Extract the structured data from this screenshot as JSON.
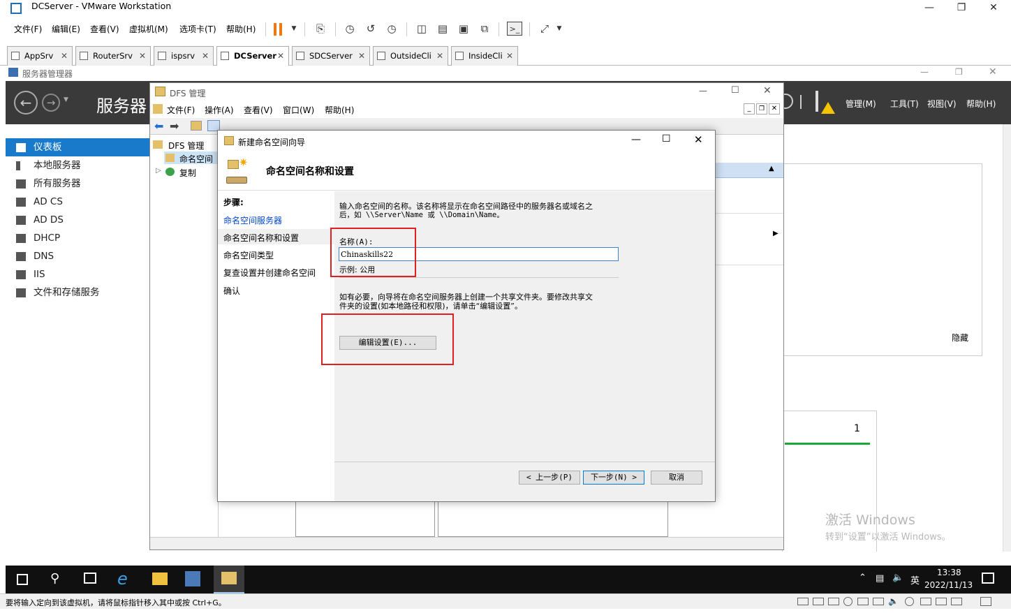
{
  "vmware": {
    "title": "DCServer - VMware Workstation",
    "menu": [
      "文件(F)",
      "编辑(E)",
      "查看(V)",
      "虚拟机(M)",
      "选项卡(T)",
      "帮助(H)"
    ],
    "tabs": [
      {
        "label": "AppSrv",
        "active": false
      },
      {
        "label": "RouterSrv",
        "active": false
      },
      {
        "label": "ispsrv",
        "active": false
      },
      {
        "label": "DCServer",
        "active": true
      },
      {
        "label": "SDCServer",
        "active": false
      },
      {
        "label": "OutsideCli",
        "active": false
      },
      {
        "label": "InsideCli",
        "active": false
      }
    ],
    "status_hint": "要将输入定向到该虚拟机，请将鼠标指针移入其中或按 Ctrl+G。"
  },
  "server_manager": {
    "title": "服务器管理器",
    "header_title": "服务器",
    "header_menu": [
      "管理(M)",
      "工具(T)",
      "视图(V)",
      "帮助(H)"
    ],
    "nav": [
      {
        "label": "仪表板",
        "selected": true
      },
      {
        "label": "本地服务器",
        "selected": false
      },
      {
        "label": "所有服务器",
        "selected": false
      },
      {
        "label": "AD CS",
        "selected": false
      },
      {
        "label": "AD DS",
        "selected": false
      },
      {
        "label": "DHCP",
        "selected": false
      },
      {
        "label": "DNS",
        "selected": false
      },
      {
        "label": "IIS",
        "selected": false
      },
      {
        "label": "文件和存储服务",
        "selected": false
      }
    ],
    "hide_label": "隐藏",
    "tile_count": "1"
  },
  "dfs": {
    "title": "DFS 管理",
    "menu": [
      "文件(F)",
      "操作(A)",
      "查看(V)",
      "窗口(W)",
      "帮助(H)"
    ],
    "tree": {
      "root": "DFS 管理",
      "namespaces": "命名空间",
      "replication": "复制"
    }
  },
  "wizard": {
    "title": "新建命名空间向导",
    "heading": "命名空间名称和设置",
    "steps_header": "步骤:",
    "steps": [
      {
        "label": "命名空间服务器",
        "state": "link"
      },
      {
        "label": "命名空间名称和设置",
        "state": "current"
      },
      {
        "label": "命名空间类型",
        "state": "normal"
      },
      {
        "label": "复查设置并创建命名空间",
        "state": "normal"
      },
      {
        "label": "确认",
        "state": "normal"
      }
    ],
    "intro_line1": "输入命名空间的名称。该名称将显示在命名空间路径中的服务器名或域名之",
    "intro_line2": "后，如 \\\\Server\\Name 或 \\\\Domain\\Name。",
    "name_label": "名称(A):",
    "name_value": "Chinaskills22",
    "example": "示例: 公用",
    "share_note_line1": "如有必要，向导将在命名空间服务器上创建一个共享文件夹。要修改共享文",
    "share_note_line2": "件夹的设置(如本地路径和权限)，请单击“编辑设置”。",
    "edit_button": "编辑设置(E)...",
    "back_button": "< 上一步(P)",
    "next_button": "下一步(N) >",
    "cancel_button": "取消"
  },
  "watermark": {
    "line1": "激活 Windows",
    "line2": "转到“设置”以激活 Windows。"
  },
  "taskbar": {
    "time": "13:38",
    "date": "2022/11/13",
    "ime": "英"
  },
  "colors": {
    "accent": "#1979ca",
    "header_bg": "#3a3a3a",
    "highlight_border": "#e02020",
    "link": "#0046d5"
  }
}
